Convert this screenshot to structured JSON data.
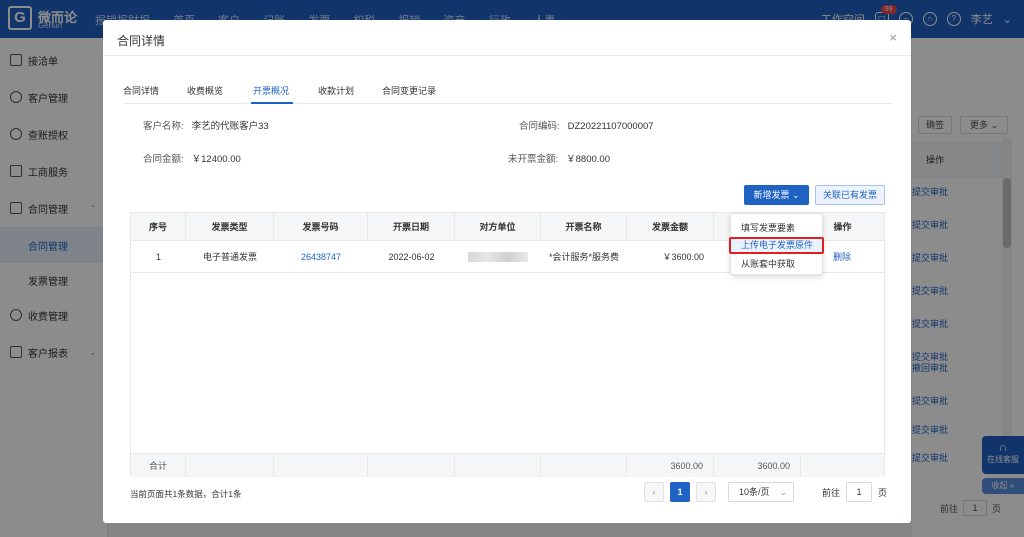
{
  "app": {
    "logo_mark": "G",
    "logo_cn": "微而论",
    "logo_en": "Gerlun",
    "top_nav": [
      "报销报财报",
      "首页",
      "客户",
      "记账",
      "发票",
      "权税",
      "报销",
      "资产",
      "行政",
      "人事"
    ],
    "top_right_text": "工作空间",
    "notification_count": "99",
    "user_name": "李艺",
    "colors": {
      "primary": "#1f62c4",
      "danger": "#e02020"
    }
  },
  "sidebar": {
    "items": [
      {
        "label": "接洽单",
        "icon": "handshake-icon"
      },
      {
        "label": "客户管理",
        "icon": "user-icon"
      },
      {
        "label": "查账授权",
        "icon": "key-icon"
      },
      {
        "label": "工商服务",
        "icon": "id-card-icon"
      },
      {
        "label": "合同管理",
        "icon": "contract-icon",
        "expanded": true
      },
      {
        "label": "合同管理",
        "sub": true,
        "active": true
      },
      {
        "label": "发票管理",
        "sub": true
      },
      {
        "label": "收费管理",
        "icon": "money-icon"
      },
      {
        "label": "客户报表",
        "icon": "chart-icon"
      }
    ]
  },
  "background": {
    "btn_reset": "确签",
    "btn_more": "更多",
    "col_action": "操作",
    "row_links": [
      "提交审批",
      "提交审批",
      "提交审批",
      "提交审批",
      "提交审批",
      "提交审批",
      "撤回审批",
      "提交审批",
      "提交审批",
      "提交审批"
    ],
    "help_label": "在线客服",
    "collapse_label": "收起",
    "goto_label": "前往",
    "goto_value": "1",
    "page_unit": "页"
  },
  "modal": {
    "title": "合同详情",
    "close": "×",
    "tabs": [
      {
        "label": "合同详情",
        "active": false
      },
      {
        "label": "收费概览",
        "active": false
      },
      {
        "label": "开票概况",
        "active": true
      },
      {
        "label": "收款计划",
        "active": false
      },
      {
        "label": "合同变更记录",
        "active": false
      }
    ],
    "info": {
      "customer_label": "客户名称:",
      "customer_value": "李艺的代账客户33",
      "code_label": "合同编码:",
      "code_value": "DZ20221107000007",
      "amount_label": "合同金额:",
      "amount_value": "￥12400.00",
      "uninvoiced_label": "未开票金额:",
      "uninvoiced_value": "￥8800.00"
    },
    "btn_new_invoice": "新增发票",
    "btn_link_invoice": "关联已有发票",
    "dropdown": [
      "填写发票要素",
      "上传电子发票原件",
      "从账套中获取"
    ],
    "table": {
      "headers": [
        "序号",
        "发票类型",
        "发票号码",
        "开票日期",
        "对方单位",
        "开票名称",
        "发票金额",
        "",
        "操作"
      ],
      "rows": [
        {
          "index": "1",
          "type": "电子普通发票",
          "number": "26438747",
          "date": "2022-06-02",
          "party": "",
          "name": "*会计服务*服务费",
          "amount": "￥3600.00",
          "extra": "",
          "action": "删除"
        }
      ],
      "summary": {
        "label": "合计",
        "amount": "3600.00",
        "extra": "3600.00"
      }
    },
    "footer": {
      "summary_text": "当前页面共1条数据，合计1条",
      "current_page": "1",
      "page_size": "10条/页",
      "goto_label": "前往",
      "goto_value": "1",
      "page_unit": "页"
    }
  }
}
